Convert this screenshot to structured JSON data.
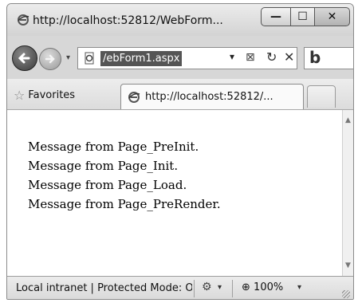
{
  "window": {
    "title": "http://localhost:52812/WebForm...",
    "caption_buttons": {
      "minimize": "—",
      "maximize": "☐",
      "close": "✕"
    }
  },
  "navbar": {
    "address_text": "/ebForm1.aspx",
    "dropdown_glyph": "▾",
    "refresh_glyph": "↻",
    "stop_glyph": "✕",
    "compat_glyph": "⊠",
    "search_logo": "b"
  },
  "favorites": {
    "label": "Favorites",
    "tab_title": "http://localhost:52812/..."
  },
  "content": {
    "messages": [
      "Message from Page_PreInit.",
      "Message from Page_Init.",
      "Message from Page_Load.",
      "Message from Page_PreRender."
    ]
  },
  "statusbar": {
    "zone_text": "Local intranet | Protected Mode: Off",
    "zoom_text": "100%",
    "dropdown_glyph": "▾"
  },
  "icons": {
    "ie_logo": "ie-logo-icon",
    "star": "star-icon",
    "zone": "network-icon",
    "protected": "protected-mode-icon",
    "zoom": "zoom-icon"
  }
}
